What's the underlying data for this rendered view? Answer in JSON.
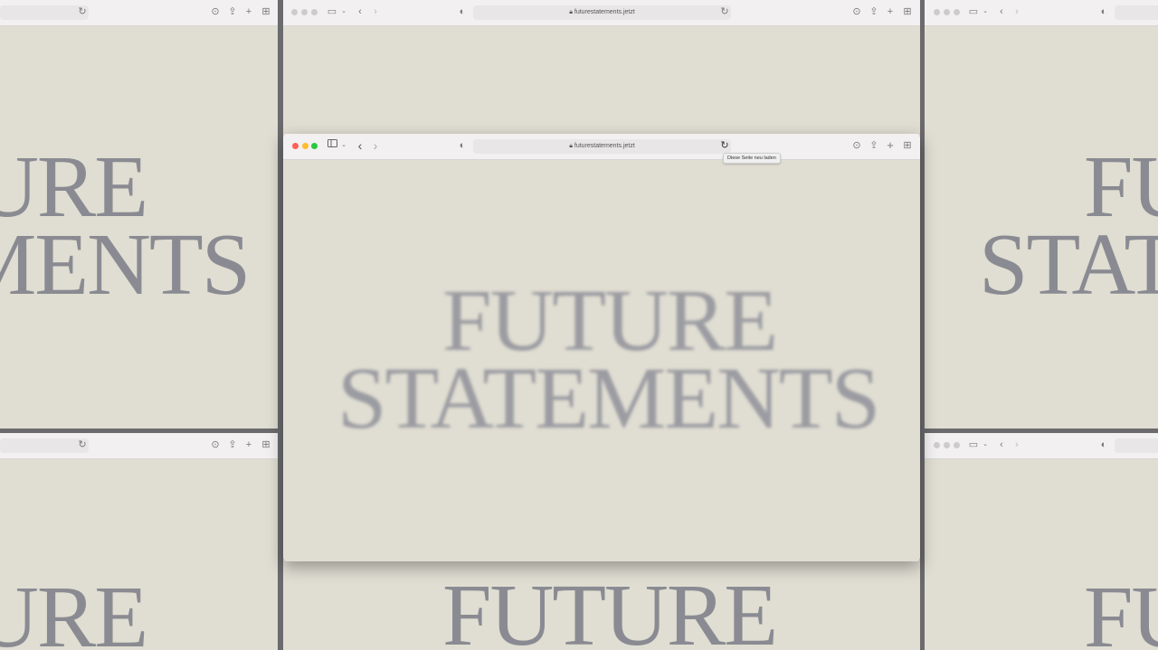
{
  "browser": {
    "url": "futurestatements.jetzt",
    "reload_tooltip": "Diese Seite neu laden"
  },
  "site": {
    "headline_line1": "FUTURE",
    "headline_line2": "STATEMENTS"
  },
  "colors": {
    "page_bg": "#e0ddd2",
    "headline": "#8a8b92",
    "close": "#ff5f57",
    "minimize": "#febc2e",
    "zoom": "#28c840"
  },
  "icons": [
    "sidebar-icon",
    "chevron-down-icon",
    "back-icon",
    "forward-icon",
    "privacy-shield-icon",
    "lock-icon",
    "reload-icon",
    "download-icon",
    "share-icon",
    "new-tab-icon",
    "tab-overview-icon"
  ]
}
